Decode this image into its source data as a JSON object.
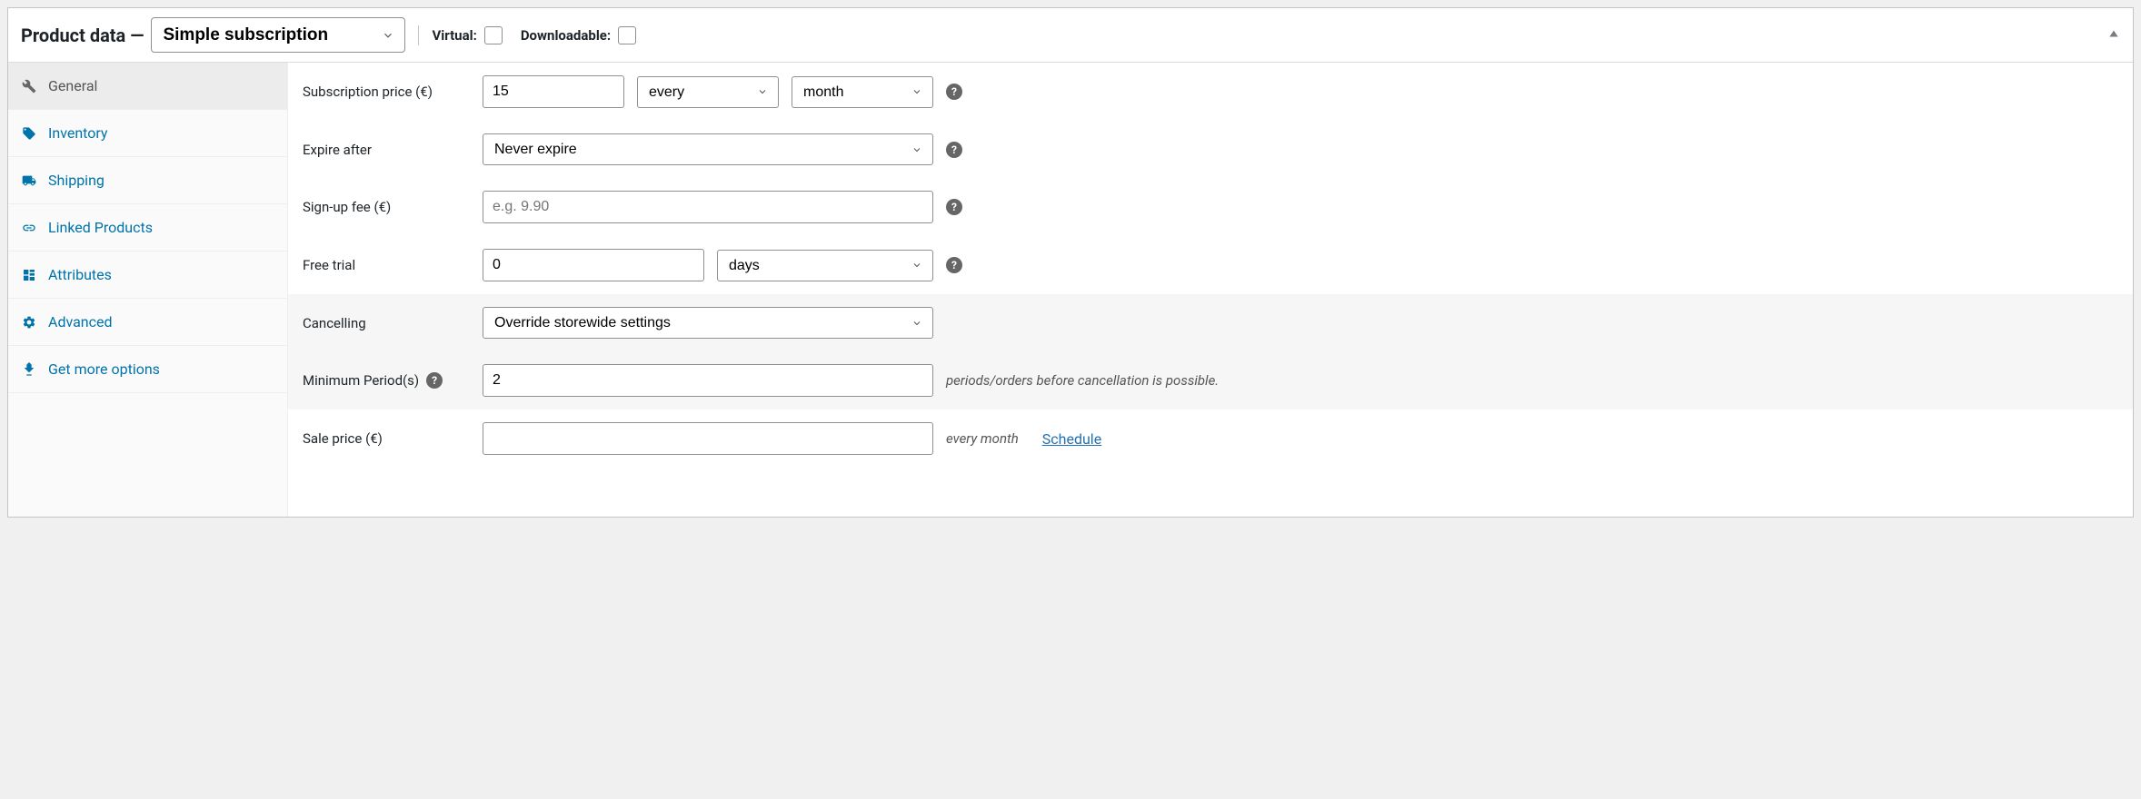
{
  "header": {
    "title": "Product data —",
    "product_type": "Simple subscription",
    "virtual_label": "Virtual:",
    "downloadable_label": "Downloadable:"
  },
  "tabs": [
    {
      "id": "general",
      "label": "General",
      "icon": "wrench-icon",
      "active": true
    },
    {
      "id": "inventory",
      "label": "Inventory",
      "icon": "tag-icon",
      "active": false
    },
    {
      "id": "shipping",
      "label": "Shipping",
      "icon": "truck-icon",
      "active": false
    },
    {
      "id": "linked",
      "label": "Linked Products",
      "icon": "link-icon",
      "active": false
    },
    {
      "id": "attributes",
      "label": "Attributes",
      "icon": "layout-icon",
      "active": false
    },
    {
      "id": "advanced",
      "label": "Advanced",
      "icon": "gear-icon",
      "active": false
    },
    {
      "id": "more",
      "label": "Get more options",
      "icon": "plugin-icon",
      "active": false
    }
  ],
  "fields": {
    "subscription_price": {
      "label": "Subscription price (€)",
      "value": "15",
      "interval": "every",
      "period": "month"
    },
    "expire_after": {
      "label": "Expire after",
      "value": "Never expire"
    },
    "signup_fee": {
      "label": "Sign-up fee (€)",
      "placeholder": "e.g. 9.90",
      "value": ""
    },
    "free_trial": {
      "label": "Free trial",
      "value": "0",
      "unit": "days"
    },
    "cancelling": {
      "label": "Cancelling",
      "value": "Override storewide settings"
    },
    "min_periods": {
      "label": "Minimum Period(s)",
      "value": "2",
      "hint": "periods/orders before cancellation is possible."
    },
    "sale_price": {
      "label": "Sale price (€)",
      "value": "",
      "suffix": "every month",
      "schedule_label": "Schedule"
    }
  },
  "colors": {
    "link": "#0073aa",
    "accent": "#2271b1"
  }
}
